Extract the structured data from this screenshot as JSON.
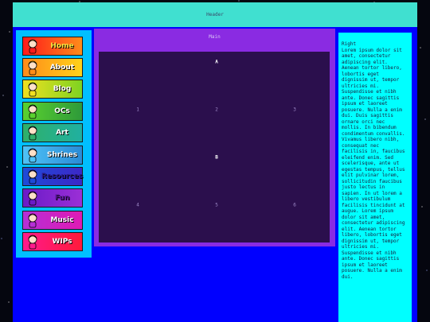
{
  "header": {
    "title": "Header"
  },
  "nav": {
    "items": [
      {
        "label": "Home",
        "icon": "character-sprite-icon",
        "colors": [
          "#ff1a1a",
          "#ff8c1a"
        ],
        "text_color": "#ffe640"
      },
      {
        "label": "About",
        "icon": "character-sprite-icon",
        "colors": [
          "#ff8c1a",
          "#ffd21a"
        ],
        "text_color": "#ffffff"
      },
      {
        "label": "Blog",
        "icon": "character-sprite-icon",
        "colors": [
          "#f0e020",
          "#7ed321"
        ],
        "text_color": "#ffffff"
      },
      {
        "label": "OCs",
        "icon": "character-sprite-icon",
        "colors": [
          "#5ad12f",
          "#2e9a3a"
        ],
        "text_color": "#ffffff"
      },
      {
        "label": "Art",
        "icon": "character-sprite-icon",
        "colors": [
          "#2fb06a",
          "#20b0a0"
        ],
        "text_color": "#ffffff"
      },
      {
        "label": "Shrines",
        "icon": "character-sprite-icon",
        "colors": [
          "#4fc3f7",
          "#2a8bd6"
        ],
        "text_color": "#ffffff"
      },
      {
        "label": "Resources",
        "icon": "character-sprite-icon",
        "colors": [
          "#1e4bd8",
          "#3c28c8"
        ],
        "text_color": "#2a1a8a"
      },
      {
        "label": "Fun",
        "icon": "character-sprite-icon",
        "colors": [
          "#6a1bc8",
          "#9b2fd6"
        ],
        "text_color": "#5a189a"
      },
      {
        "label": "Music",
        "icon": "character-sprite-icon",
        "colors": [
          "#b62fd6",
          "#e01ab4"
        ],
        "text_color": "#ffffff"
      },
      {
        "label": "WIPs",
        "icon": "character-sprite-icon",
        "colors": [
          "#ff1a8c",
          "#ff1a3a"
        ],
        "text_color": "#ffffff"
      }
    ]
  },
  "main": {
    "title": "Main",
    "sections": [
      {
        "label": "A",
        "cells": [
          "1",
          "2",
          "3"
        ]
      },
      {
        "label": "B",
        "cells": [
          "4",
          "5",
          "6"
        ]
      }
    ]
  },
  "right": {
    "title": "Right",
    "body": "Lorem ipsum dolor sit amet, consectetur adipiscing elit. Aenean tortor libero, lobortis eget dignissim ut, tempor ultricies mi. Suspendisse et nibh ante. Donec sagittis ipsum et laoreet posuere. Nulla a enim dui. Duis sagittis ornare orci nec mollis. In bibendum condimentum convallis. Vivamus libero nibh, consequat nec facilisis in, faucibus eleifend enim. Sed scelerisque, ante ut egestas tempus, tellus elit pulvinar lorem, sollicitudin faucibus justo lectus in sapien. In ut lorem a libero vestibulum facilisis tincidunt at augue. Lorem ipsum dolor sit amet, consectetur adipiscing elit. Aenean tortor libero, lobortis eget dignissim ut, tempor ultricies mi. Suspendisse et nibh ante. Donec sagittis ipsum et laoreet posuere. Nulla a enim dui."
  }
}
